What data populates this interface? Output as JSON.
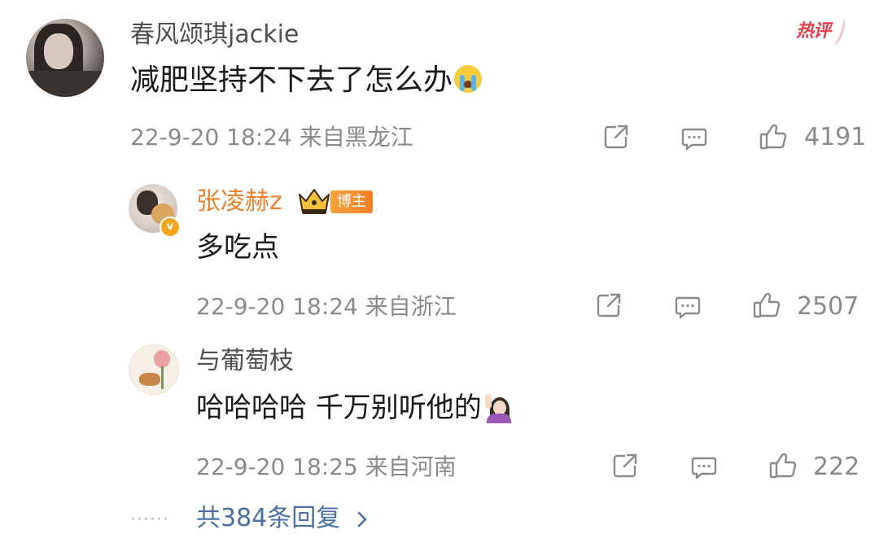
{
  "comment": {
    "username": "春风颂琪jackie",
    "hot_label": "热评",
    "text": "减肥坚持不下去了怎么办",
    "emoji": "crying-face-emoji",
    "meta": "22-9-20 18:24  来自黑龙江",
    "likes": "4191"
  },
  "replies": [
    {
      "username": "张凌赫z",
      "badge": "博主",
      "verified_mark": "v",
      "text": "多吃点",
      "meta": "22-9-20 18:24  来自浙江",
      "likes": "2507"
    },
    {
      "username": "与葡萄枝",
      "text": "哈哈哈哈 千万别听他的",
      "emoji": "woman-raising-hand-emoji",
      "meta": "22-9-20 18:25  来自河南",
      "likes": "222"
    }
  ],
  "footer": {
    "dots": "······",
    "more_replies": "共384条回复"
  },
  "colors": {
    "blogger_orange": "#f0802a",
    "hot_red": "#e8404a",
    "link_blue": "#4a6fa5",
    "meta_gray": "#8a8a8a"
  }
}
